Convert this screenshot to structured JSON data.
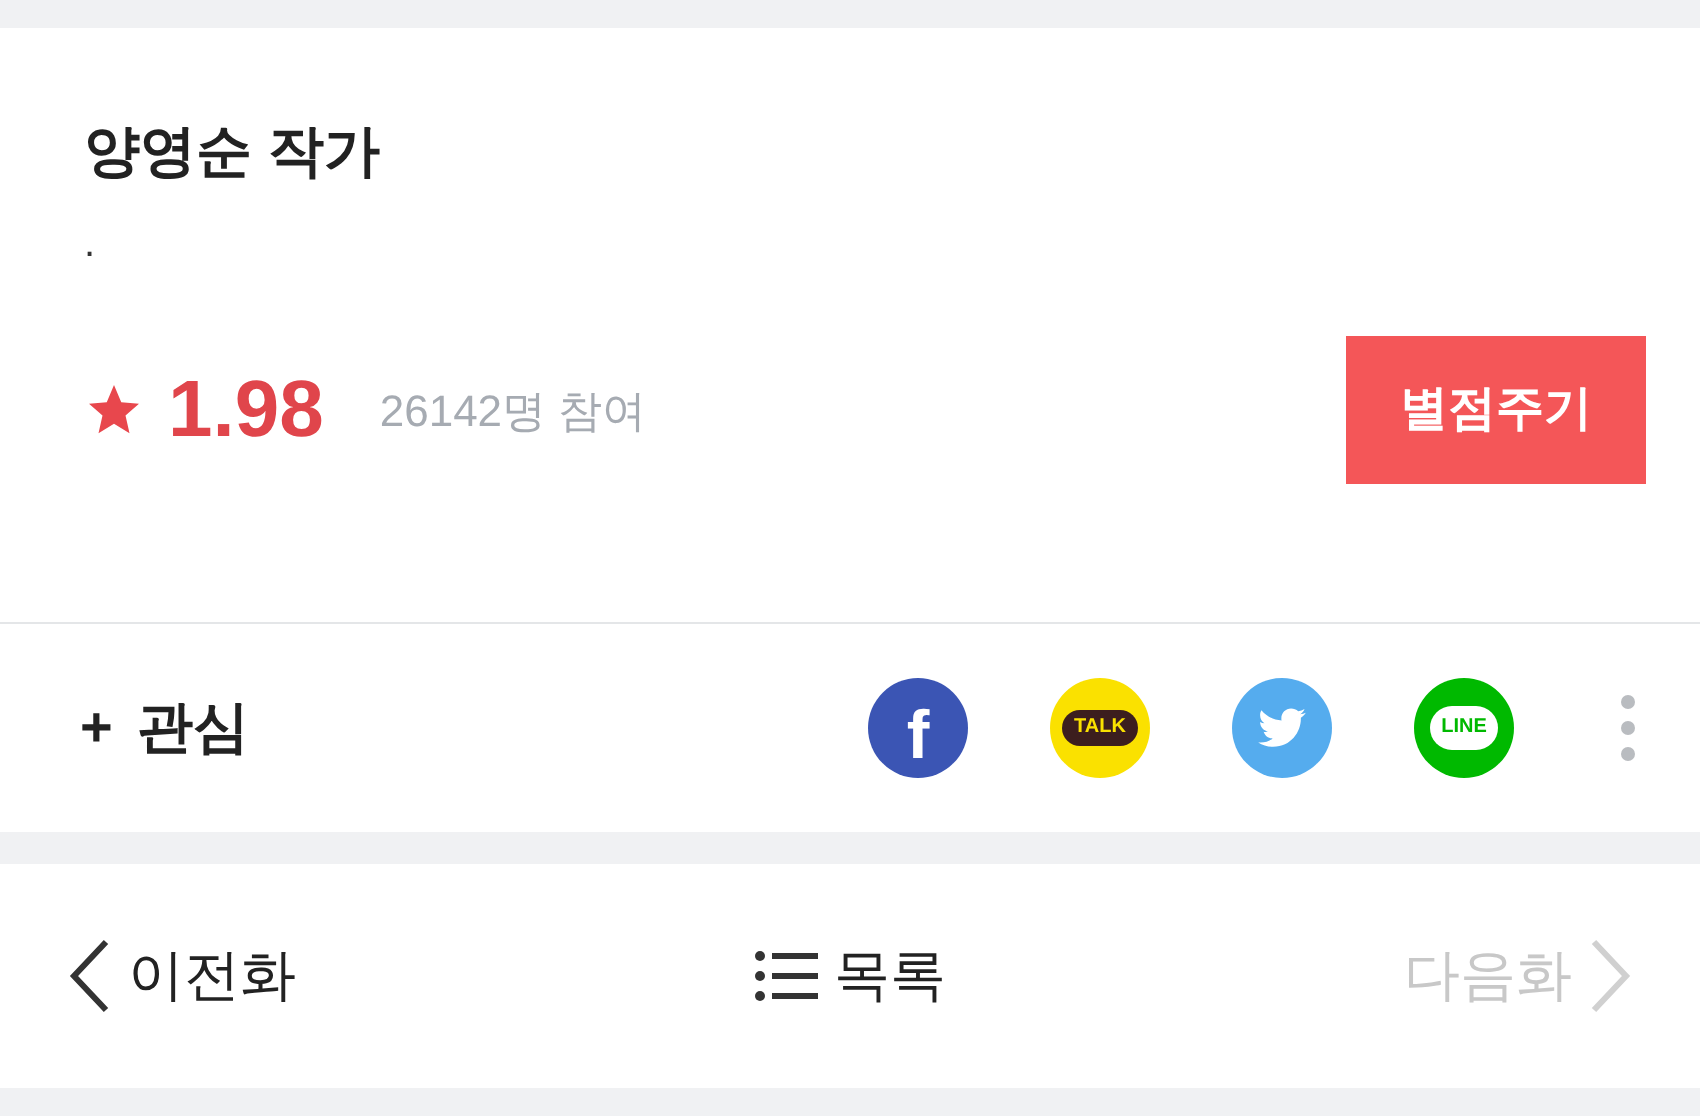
{
  "author": {
    "title": "양영순 작가",
    "description": "."
  },
  "rating": {
    "score": "1.98",
    "participants": "26142명 참여",
    "button": "별점주기"
  },
  "interest": {
    "icon": "+",
    "label": "관심"
  },
  "share": [
    {
      "kind": "facebook",
      "glyph": "f"
    },
    {
      "kind": "kakao",
      "glyph": "TALK"
    },
    {
      "kind": "twitter"
    },
    {
      "kind": "line",
      "glyph": "LINE"
    }
  ],
  "nav": [
    {
      "kind": "prev",
      "label": "이전화",
      "disabled": false
    },
    {
      "kind": "list",
      "label": "목록",
      "disabled": false
    },
    {
      "kind": "next",
      "label": "다음화",
      "disabled": true
    }
  ]
}
